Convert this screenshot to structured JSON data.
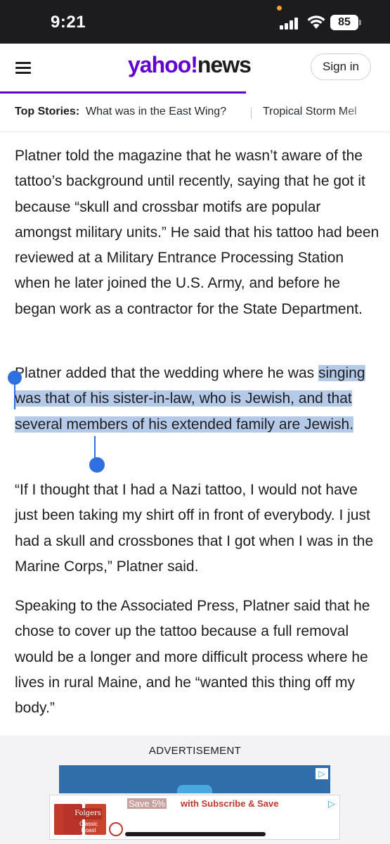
{
  "status_bar": {
    "time": "9:21",
    "battery": "85",
    "icons": [
      "signal-icon",
      "wifi-icon",
      "battery-icon"
    ]
  },
  "header": {
    "logo_yahoo": "yahoo!",
    "logo_news": "news",
    "signin_label": "Sign in",
    "brand_color": "#6001d2",
    "menu_icon": "hamburger-menu-icon"
  },
  "top_stories": {
    "label": "Top Stories:",
    "items": [
      "What was in the East Wing?",
      "Tropical Storm Mel"
    ]
  },
  "article": {
    "p1": "Platner told the magazine that he wasn’t aware of the tattoo’s background until recently, saying that he got it because “skull and crossbar motifs are popular amongst military units.” He said that his tattoo had been reviewed at a Military Entrance Processing Station when he later joined the U.S. Army, and before he began work as a contractor for the State Department.",
    "p2_before": "Platner added that the wedding where he was ",
    "p2_selected": "singing was that of his sister-in-law, who is Jewish, and that several members of his extended family are Jewish.",
    "p3": "“If I thought that I had a Nazi tattoo, I would not have just been taking my shirt off in front of everybody. I just had a skull and crossbones that I got when I was in the Marine Corps,” Platner said.",
    "p4": "Speaking to the Associated Press, Platner said that he chose to cover up the tattoo because a full removal would be a longer and more difficult process where he lives in rural Maine, and he “wanted this thing off my body.”",
    "selection_color": "#b5cae8",
    "handle_color": "#2f6fe0"
  },
  "ad": {
    "label": "ADVERTISEMENT",
    "brand": "Folgers",
    "product_subtitle": "Classic Roast",
    "save_text": "Save 5%",
    "cta": "with Subscribe & Save",
    "adchoices_icon": "adchoices-icon"
  }
}
